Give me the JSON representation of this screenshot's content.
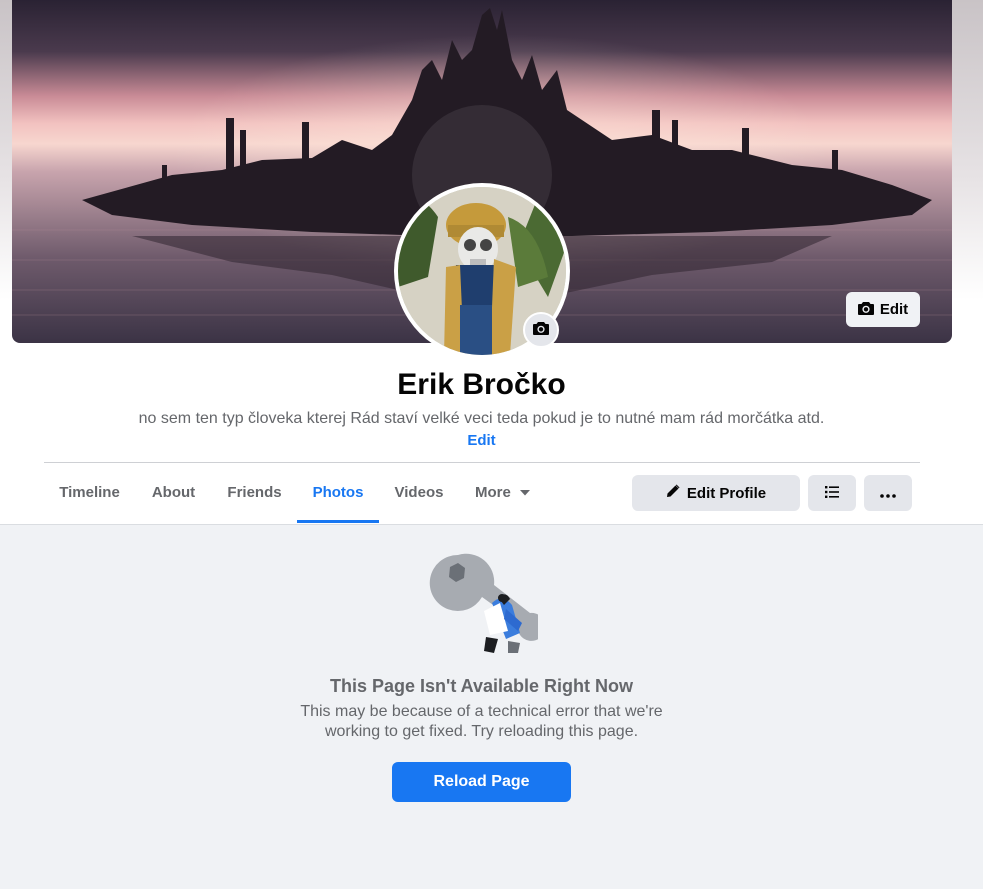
{
  "profile": {
    "name": "Erik Bročko",
    "bio": "no sem ten typ človeka kterej Rád staví velké veci teda pokud je to nutné mam rád morčátka atd.",
    "bio_edit_label": "Edit"
  },
  "cover": {
    "edit_label": "Edit"
  },
  "tabs": [
    {
      "label": "Timeline"
    },
    {
      "label": "About"
    },
    {
      "label": "Friends"
    },
    {
      "label": "Photos",
      "active": true
    },
    {
      "label": "Videos"
    },
    {
      "label": "More"
    }
  ],
  "actions": {
    "edit_profile_label": "Edit Profile"
  },
  "error": {
    "title": "This Page Isn't Available Right Now",
    "message": "This may be because of a technical error that we're working to get fixed. Try reloading this page.",
    "reload_label": "Reload Page"
  },
  "colors": {
    "accent": "#1877f2",
    "secondary_text": "#65676b",
    "button_gray": "#e4e6eb",
    "page_bg": "#f0f2f5"
  },
  "icons": {
    "cover_edit": "camera-icon",
    "avatar_edit": "camera-icon",
    "more_tab": "caret-down-icon",
    "edit_profile": "pencil-icon",
    "list_view": "list-icon",
    "overflow": "ellipsis-icon",
    "error_illustration": "wrench-icon"
  }
}
